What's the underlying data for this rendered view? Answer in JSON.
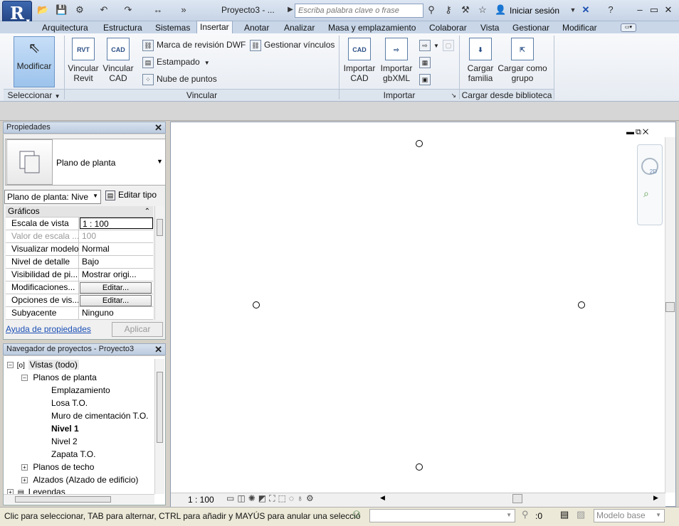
{
  "titlebar": {
    "app_button_letter": "R",
    "doc_title": "Proyecto3 - ...",
    "search_placeholder": "Escriba palabra clave o frase",
    "signin_label": "Iniciar sesión"
  },
  "tabs": [
    "Arquitectura",
    "Estructura",
    "Sistemas",
    "Insertar",
    "Anotar",
    "Analizar",
    "Masa y emplazamiento",
    "Colaborar",
    "Vista",
    "Gestionar",
    "Modificar"
  ],
  "active_tab": "Insertar",
  "ribbon": {
    "modificar": "Modificar",
    "vincular_revit": [
      "Vincular",
      "Revit"
    ],
    "vincular_cad": [
      "Vincular",
      "CAD"
    ],
    "marca_dwf": "Marca de revisión DWF",
    "estampado": "Estampado",
    "nube_puntos": "Nube de puntos",
    "gestionar_vinculos": "Gestionar vínculos",
    "importar_cad": [
      "Importar",
      "CAD"
    ],
    "importar_gbxml": [
      "Importar",
      "gbXML"
    ],
    "cargar_familia": [
      "Cargar",
      "familia"
    ],
    "cargar_grupo": [
      "Cargar como",
      "grupo"
    ],
    "panels": {
      "seleccionar": "Seleccionar",
      "vincular": "Vincular",
      "importar": "Importar",
      "cargar": "Cargar desde biblioteca"
    },
    "icon_labels": {
      "rvt": "RVT",
      "cad": "CAD"
    }
  },
  "properties": {
    "header": "Propiedades",
    "type_name": "Plano de planta",
    "instance_selector": "Plano de planta: Nive",
    "edit_type": "Editar tipo",
    "group": "Gráficos",
    "rows": [
      {
        "k": "Escala de vista",
        "v": "1 : 100"
      },
      {
        "k": "Valor de escala ...",
        "v": "100"
      },
      {
        "k": "Visualizar modelo",
        "v": "Normal"
      },
      {
        "k": "Nivel de detalle",
        "v": "Bajo"
      },
      {
        "k": "Visibilidad de pi...",
        "v": "Mostrar origi..."
      },
      {
        "k": "Modificaciones...",
        "v": "Editar..."
      },
      {
        "k": "Opciones de vis...",
        "v": "Editar..."
      },
      {
        "k": "Subyacente",
        "v": "Ninguno"
      }
    ],
    "help_link": "Ayuda de propiedades",
    "apply": "Aplicar"
  },
  "browser": {
    "header": "Navegador de proyectos - Proyecto3",
    "root": "Vistas (todo)",
    "planos_planta": "Planos de planta",
    "items": [
      "Emplazamiento",
      "Losa T.O.",
      "Muro de cimentación T.O.",
      "Nivel 1",
      "Nivel 2",
      "Zapata T.O."
    ],
    "planos_techo": "Planos de techo",
    "alzados": "Alzados (Alzado de edificio)",
    "leyendas": "Leyendas"
  },
  "view": {
    "scale": "1 : 100"
  },
  "status": {
    "text": "Clic para seleccionar, TAB para alternar, CTRL para añadir y MAYÚS para anular una selecció",
    "count": ":0",
    "model": "Modelo base"
  }
}
